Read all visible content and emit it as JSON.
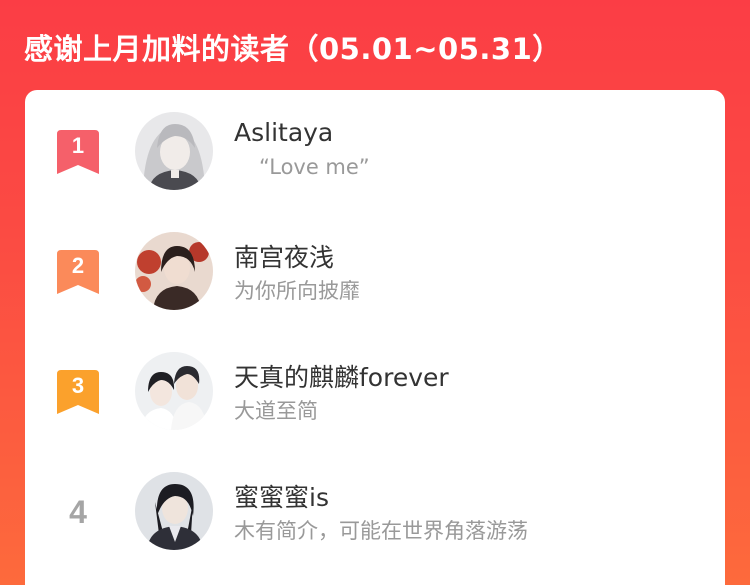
{
  "header": {
    "title": "感谢上月加料的读者（05.01~05.31）"
  },
  "readers": [
    {
      "rank": "1",
      "name": "Aslitaya",
      "bio": "“Love me”",
      "badge_color": "#f5606a"
    },
    {
      "rank": "2",
      "name": "南宫夜浅",
      "bio": "为你所向披靡",
      "badge_color": "#fb8a5a"
    },
    {
      "rank": "3",
      "name": "天真的麒麟forever",
      "bio": "大道至简",
      "badge_color": "#fba12c"
    },
    {
      "rank": "4",
      "name": "蜜蜜蜜is",
      "bio": "木有简介，可能在世界角落游荡"
    }
  ],
  "colors": {
    "background_top": "#fb3d45",
    "background_bottom": "#fd6a3c",
    "name_text": "#333333",
    "bio_text": "#999999",
    "rank_plain": "#a5a5a5"
  },
  "icons": {
    "rank_badge": "ribbon-badge-icon"
  }
}
